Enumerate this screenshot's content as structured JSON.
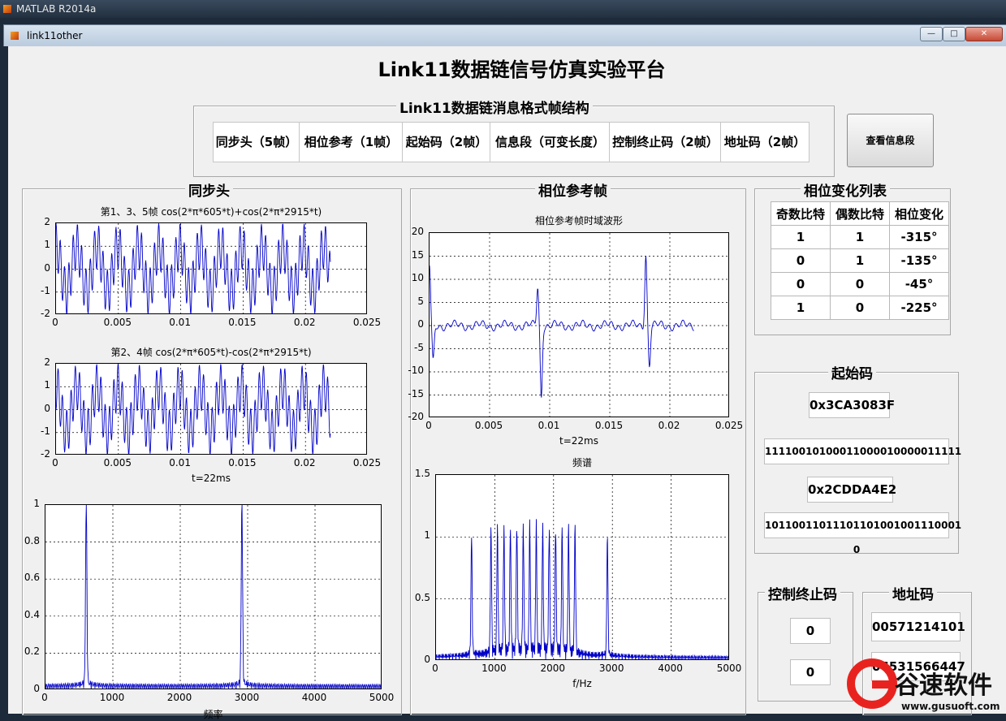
{
  "outer_window": {
    "title": "MATLAB R2014a"
  },
  "window": {
    "title": "link11other",
    "buttons": [
      "—",
      "□",
      "✕"
    ]
  },
  "main_title": "Link11数据链信号仿真实验平台",
  "frame_panel": {
    "title": "Link11数据链消息格式帧结构",
    "cells": [
      "同步头（5帧）",
      "相位参考（1帧）",
      "起始码（2帧）",
      "信息段（可变长度）",
      "控制终止码（2帧）",
      "地址码（2帧）"
    ]
  },
  "view_info_button": "查看信息段",
  "sync_panel": {
    "title": "同步头"
  },
  "phase_panel": {
    "title": "相位参考帧"
  },
  "phase_table_panel": {
    "title": "相位变化列表",
    "headers": [
      "奇数比特",
      "偶数比特",
      "相位变化"
    ],
    "rows": [
      [
        "1",
        "1",
        "-315°"
      ],
      [
        "0",
        "1",
        "-135°"
      ],
      [
        "0",
        "0",
        "-45°"
      ],
      [
        "1",
        "0",
        "-225°"
      ]
    ]
  },
  "start_code_panel": {
    "title": "起始码",
    "values": [
      "0x3CA3083F",
      "11110010100011000010000011111",
      "0x2CDDA4E2",
      "10110011011101101001001110001​0"
    ]
  },
  "stop_panel": {
    "title": "控制终止码",
    "values": [
      "0",
      "0"
    ]
  },
  "address_panel": {
    "title": "地址码",
    "values": [
      "00571214101",
      "06531566447"
    ]
  },
  "brand": {
    "name": "谷速软件",
    "url": "www.gusuoft.com"
  },
  "chart_data": [
    {
      "id": "sync1",
      "type": "line",
      "title": "第1、3、5帧  cos(2*π*605*t)+cos(2*π*2915*t)",
      "xlabel": "",
      "ylim": [
        -2,
        2
      ],
      "xlim": [
        0,
        0.025
      ],
      "xticks": [
        "0",
        "0.005",
        "0.01",
        "0.015",
        "0.02",
        "0.025"
      ],
      "yticks": [
        "-2",
        "-1",
        "0",
        "1",
        "2"
      ],
      "series": [
        {
          "f1": 605,
          "f2": 2915,
          "sign": 1,
          "tmax": 0.022
        }
      ]
    },
    {
      "id": "sync2",
      "type": "line",
      "title": "第2、4帧  cos(2*π*605*t)-cos(2*π*2915*t)",
      "xlabel": "t=22ms",
      "ylim": [
        -2,
        2
      ],
      "xlim": [
        0,
        0.025
      ],
      "xticks": [
        "0",
        "0.005",
        "0.01",
        "0.015",
        "0.02",
        "0.025"
      ],
      "yticks": [
        "-2",
        "-1",
        "0",
        "1",
        "2"
      ],
      "series": [
        {
          "f1": 605,
          "f2": 2915,
          "sign": -1,
          "tmax": 0.022
        }
      ]
    },
    {
      "id": "sync_spec",
      "type": "line",
      "title": "",
      "xlabel": "频率",
      "ylim": [
        0,
        1
      ],
      "xlim": [
        0,
        5000
      ],
      "xticks": [
        "0",
        "1000",
        "2000",
        "3000",
        "4000",
        "5000"
      ],
      "yticks": [
        "0",
        "0.2",
        "0.4",
        "0.6",
        "0.8",
        "1"
      ],
      "series": [
        {
          "peaks": [
            [
              605,
              0.97
            ],
            [
              2915,
              0.97
            ]
          ]
        }
      ]
    },
    {
      "id": "phase_time",
      "type": "line",
      "title": "相位参考帧时域波形",
      "xlabel": "t=22ms",
      "ylim": [
        -20,
        20
      ],
      "xlim": [
        0,
        0.025
      ],
      "xticks": [
        "0",
        "0.005",
        "0.01",
        "0.015",
        "0.02",
        "0.025"
      ],
      "yticks": [
        "-20",
        "-15",
        "-10",
        "-5",
        "0",
        "5",
        "10",
        "15",
        "20"
      ],
      "series": [
        {
          "spikes": [
            [
              0.0,
              13
            ],
            [
              0.0003,
              -8
            ],
            [
              0.009,
              8.5
            ],
            [
              0.0093,
              -15.5
            ],
            [
              0.018,
              15.5
            ],
            [
              0.0183,
              -8.5
            ]
          ],
          "tmax": 0.022
        }
      ]
    },
    {
      "id": "phase_spec",
      "type": "line",
      "title": "频谱",
      "xlabel": "f/Hz",
      "ylim": [
        0,
        1.5
      ],
      "xlim": [
        0,
        5000
      ],
      "xticks": [
        "0",
        "1000",
        "2000",
        "3000",
        "4000",
        "5000"
      ],
      "yticks": [
        "0",
        "0.5",
        "1",
        "1.5"
      ],
      "series": [
        {
          "peaks": [
            [
              605,
              0.93
            ],
            [
              935,
              0.97
            ],
            [
              1045,
              0.97
            ],
            [
              1155,
              0.97
            ],
            [
              1265,
              0.97
            ],
            [
              1375,
              0.97
            ],
            [
              1485,
              0.97
            ],
            [
              1595,
              0.97
            ],
            [
              1705,
              0.97
            ],
            [
              1815,
              0.97
            ],
            [
              1925,
              0.97
            ],
            [
              2035,
              0.97
            ],
            [
              2145,
              0.97
            ],
            [
              2255,
              0.97
            ],
            [
              2365,
              0.97
            ],
            [
              2915,
              0.93
            ]
          ]
        }
      ]
    }
  ]
}
